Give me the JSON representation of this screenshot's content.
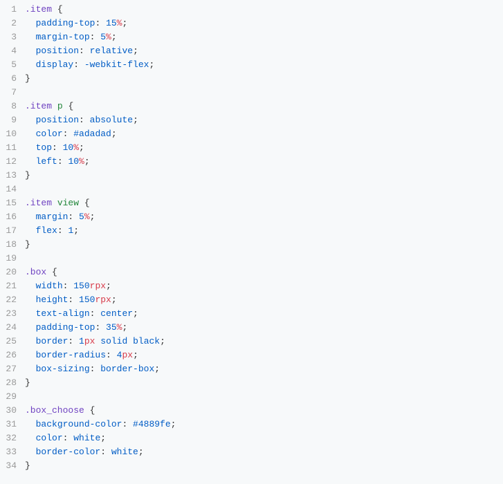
{
  "lines": [
    {
      "num": 1,
      "indent": 0,
      "tokens": [
        {
          "t": "class-sel",
          "v": ".item"
        },
        {
          "t": "plain",
          "v": " "
        },
        {
          "t": "brace",
          "v": "{"
        }
      ]
    },
    {
      "num": 2,
      "indent": 1,
      "tokens": [
        {
          "t": "prop",
          "v": "padding-top"
        },
        {
          "t": "colon",
          "v": ": "
        },
        {
          "t": "number",
          "v": "15"
        },
        {
          "t": "unit",
          "v": "%"
        },
        {
          "t": "semi",
          "v": ";"
        }
      ]
    },
    {
      "num": 3,
      "indent": 1,
      "tokens": [
        {
          "t": "prop",
          "v": "margin-top"
        },
        {
          "t": "colon",
          "v": ": "
        },
        {
          "t": "number",
          "v": "5"
        },
        {
          "t": "unit",
          "v": "%"
        },
        {
          "t": "semi",
          "v": ";"
        }
      ]
    },
    {
      "num": 4,
      "indent": 1,
      "tokens": [
        {
          "t": "prop",
          "v": "position"
        },
        {
          "t": "colon",
          "v": ": "
        },
        {
          "t": "keyword",
          "v": "relative"
        },
        {
          "t": "semi",
          "v": ";"
        }
      ]
    },
    {
      "num": 5,
      "indent": 1,
      "tokens": [
        {
          "t": "prop",
          "v": "display"
        },
        {
          "t": "colon",
          "v": ": "
        },
        {
          "t": "keyword",
          "v": "-webkit-flex"
        },
        {
          "t": "semi",
          "v": ";"
        }
      ]
    },
    {
      "num": 6,
      "indent": 0,
      "tokens": [
        {
          "t": "brace",
          "v": "}"
        }
      ]
    },
    {
      "num": 7,
      "indent": 0,
      "tokens": []
    },
    {
      "num": 8,
      "indent": 0,
      "tokens": [
        {
          "t": "class-sel",
          "v": ".item"
        },
        {
          "t": "plain",
          "v": " "
        },
        {
          "t": "tag-sel",
          "v": "p"
        },
        {
          "t": "plain",
          "v": " "
        },
        {
          "t": "brace",
          "v": "{"
        }
      ]
    },
    {
      "num": 9,
      "indent": 1,
      "tokens": [
        {
          "t": "prop",
          "v": "position"
        },
        {
          "t": "colon",
          "v": ": "
        },
        {
          "t": "keyword",
          "v": "absolute"
        },
        {
          "t": "semi",
          "v": ";"
        }
      ]
    },
    {
      "num": 10,
      "indent": 1,
      "tokens": [
        {
          "t": "prop",
          "v": "color"
        },
        {
          "t": "colon",
          "v": ": "
        },
        {
          "t": "color-val",
          "v": "#adadad"
        },
        {
          "t": "semi",
          "v": ";"
        }
      ]
    },
    {
      "num": 11,
      "indent": 1,
      "tokens": [
        {
          "t": "prop",
          "v": "top"
        },
        {
          "t": "colon",
          "v": ": "
        },
        {
          "t": "number",
          "v": "10"
        },
        {
          "t": "unit",
          "v": "%"
        },
        {
          "t": "semi",
          "v": ";"
        }
      ]
    },
    {
      "num": 12,
      "indent": 1,
      "tokens": [
        {
          "t": "prop",
          "v": "left"
        },
        {
          "t": "colon",
          "v": ": "
        },
        {
          "t": "number",
          "v": "10"
        },
        {
          "t": "unit",
          "v": "%"
        },
        {
          "t": "semi",
          "v": ";"
        }
      ]
    },
    {
      "num": 13,
      "indent": 0,
      "tokens": [
        {
          "t": "brace",
          "v": "}"
        }
      ]
    },
    {
      "num": 14,
      "indent": 0,
      "tokens": []
    },
    {
      "num": 15,
      "indent": 0,
      "tokens": [
        {
          "t": "class-sel",
          "v": ".item"
        },
        {
          "t": "plain",
          "v": " "
        },
        {
          "t": "tag-sel",
          "v": "view"
        },
        {
          "t": "plain",
          "v": " "
        },
        {
          "t": "brace",
          "v": "{"
        }
      ]
    },
    {
      "num": 16,
      "indent": 1,
      "tokens": [
        {
          "t": "prop",
          "v": "margin"
        },
        {
          "t": "colon",
          "v": ": "
        },
        {
          "t": "number",
          "v": "5"
        },
        {
          "t": "unit",
          "v": "%"
        },
        {
          "t": "semi",
          "v": ";"
        }
      ]
    },
    {
      "num": 17,
      "indent": 1,
      "tokens": [
        {
          "t": "prop",
          "v": "flex"
        },
        {
          "t": "colon",
          "v": ": "
        },
        {
          "t": "number",
          "v": "1"
        },
        {
          "t": "semi",
          "v": ";"
        }
      ]
    },
    {
      "num": 18,
      "indent": 0,
      "tokens": [
        {
          "t": "brace",
          "v": "}"
        }
      ]
    },
    {
      "num": 19,
      "indent": 0,
      "tokens": []
    },
    {
      "num": 20,
      "indent": 0,
      "tokens": [
        {
          "t": "class-sel",
          "v": ".box"
        },
        {
          "t": "plain",
          "v": " "
        },
        {
          "t": "brace",
          "v": "{"
        }
      ]
    },
    {
      "num": 21,
      "indent": 1,
      "tokens": [
        {
          "t": "prop",
          "v": "width"
        },
        {
          "t": "colon",
          "v": ": "
        },
        {
          "t": "number",
          "v": "150"
        },
        {
          "t": "unit",
          "v": "rpx"
        },
        {
          "t": "semi",
          "v": ";"
        }
      ]
    },
    {
      "num": 22,
      "indent": 1,
      "tokens": [
        {
          "t": "prop",
          "v": "height"
        },
        {
          "t": "colon",
          "v": ": "
        },
        {
          "t": "number",
          "v": "150"
        },
        {
          "t": "unit",
          "v": "rpx"
        },
        {
          "t": "semi",
          "v": ";"
        }
      ]
    },
    {
      "num": 23,
      "indent": 1,
      "tokens": [
        {
          "t": "prop",
          "v": "text-align"
        },
        {
          "t": "colon",
          "v": ": "
        },
        {
          "t": "keyword",
          "v": "center"
        },
        {
          "t": "semi",
          "v": ";"
        }
      ]
    },
    {
      "num": 24,
      "indent": 1,
      "tokens": [
        {
          "t": "prop",
          "v": "padding-top"
        },
        {
          "t": "colon",
          "v": ": "
        },
        {
          "t": "number",
          "v": "35"
        },
        {
          "t": "unit",
          "v": "%"
        },
        {
          "t": "semi",
          "v": ";"
        }
      ]
    },
    {
      "num": 25,
      "indent": 1,
      "tokens": [
        {
          "t": "prop",
          "v": "border"
        },
        {
          "t": "colon",
          "v": ": "
        },
        {
          "t": "number",
          "v": "1"
        },
        {
          "t": "unit",
          "v": "px"
        },
        {
          "t": "plain",
          "v": " "
        },
        {
          "t": "keyword",
          "v": "solid"
        },
        {
          "t": "plain",
          "v": " "
        },
        {
          "t": "keyword",
          "v": "black"
        },
        {
          "t": "semi",
          "v": ";"
        }
      ]
    },
    {
      "num": 26,
      "indent": 1,
      "tokens": [
        {
          "t": "prop",
          "v": "border-radius"
        },
        {
          "t": "colon",
          "v": ": "
        },
        {
          "t": "number",
          "v": "4"
        },
        {
          "t": "unit",
          "v": "px"
        },
        {
          "t": "semi",
          "v": ";"
        }
      ]
    },
    {
      "num": 27,
      "indent": 1,
      "tokens": [
        {
          "t": "prop",
          "v": "box-sizing"
        },
        {
          "t": "colon",
          "v": ": "
        },
        {
          "t": "keyword",
          "v": "border-box"
        },
        {
          "t": "semi",
          "v": ";"
        }
      ]
    },
    {
      "num": 28,
      "indent": 0,
      "tokens": [
        {
          "t": "brace",
          "v": "}"
        }
      ]
    },
    {
      "num": 29,
      "indent": 0,
      "tokens": []
    },
    {
      "num": 30,
      "indent": 0,
      "tokens": [
        {
          "t": "class-sel",
          "v": ".box_choose"
        },
        {
          "t": "plain",
          "v": " "
        },
        {
          "t": "brace",
          "v": "{"
        }
      ]
    },
    {
      "num": 31,
      "indent": 1,
      "tokens": [
        {
          "t": "prop",
          "v": "background-color"
        },
        {
          "t": "colon",
          "v": ": "
        },
        {
          "t": "color-val",
          "v": "#4889fe"
        },
        {
          "t": "semi",
          "v": ";"
        }
      ]
    },
    {
      "num": 32,
      "indent": 1,
      "tokens": [
        {
          "t": "prop",
          "v": "color"
        },
        {
          "t": "colon",
          "v": ": "
        },
        {
          "t": "keyword",
          "v": "white"
        },
        {
          "t": "semi",
          "v": ";"
        }
      ]
    },
    {
      "num": 33,
      "indent": 1,
      "tokens": [
        {
          "t": "prop",
          "v": "border-color"
        },
        {
          "t": "colon",
          "v": ": "
        },
        {
          "t": "keyword",
          "v": "white"
        },
        {
          "t": "semi",
          "v": ";"
        }
      ]
    },
    {
      "num": 34,
      "indent": 0,
      "tokens": [
        {
          "t": "brace",
          "v": "}"
        }
      ]
    }
  ]
}
